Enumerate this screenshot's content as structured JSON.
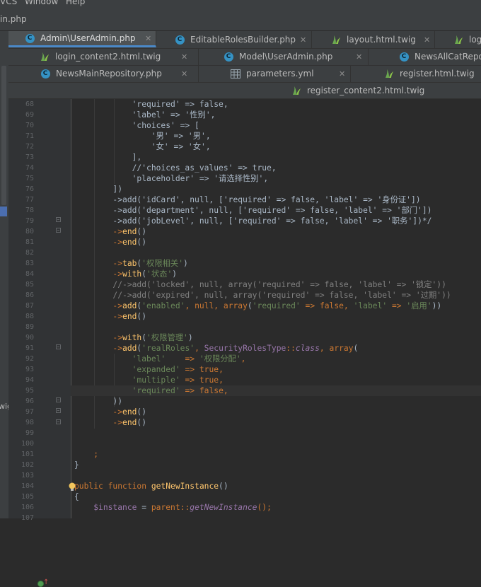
{
  "menu": [
    "VCS",
    "Window",
    "Help"
  ],
  "navbar": {
    "path": "in.php"
  },
  "sidebar": {
    "cut_text": "wig"
  },
  "tabs": [
    {
      "label": "Admin\\UserAdmin.php",
      "icon": "php-class-icon",
      "active": true
    },
    {
      "label": "EditableRolesBuilder.php",
      "icon": "php-class-icon",
      "active": false
    },
    {
      "label": "layout.html.twig",
      "icon": "twig-icon",
      "active": false
    },
    {
      "label": "log",
      "icon": "twig-icon",
      "active": false
    },
    {
      "label": "login_content2.html.twig",
      "icon": "twig-icon",
      "active": false
    },
    {
      "label": "Model\\UserAdmin.php",
      "icon": "php-class-icon",
      "active": false
    },
    {
      "label": "NewsAllCatRepo",
      "icon": "php-class-icon",
      "active": false
    },
    {
      "label": "NewsMainRepository.php",
      "icon": "php-class-icon",
      "active": false
    },
    {
      "label": "parameters.yml",
      "icon": "yml-icon",
      "active": false
    },
    {
      "label": "register.html.twig",
      "icon": "twig-icon",
      "active": false
    },
    {
      "label": "register_content2.html.twig",
      "icon": "twig-icon",
      "active": false
    }
  ],
  "editor": {
    "current_line": 95,
    "lines": [
      {
        "n": "68",
        "code": [
          [
            "            'required' => false,",
            ""
          ]
        ]
      },
      {
        "n": "69",
        "code": [
          [
            "            'label' => '性别',",
            ""
          ]
        ]
      },
      {
        "n": "70",
        "code": [
          [
            "            'choices' => [",
            ""
          ]
        ]
      },
      {
        "n": "71",
        "code": [
          [
            "                '男' => '男',",
            ""
          ]
        ]
      },
      {
        "n": "72",
        "code": [
          [
            "                '女' => '女',",
            ""
          ]
        ]
      },
      {
        "n": "73",
        "code": [
          [
            "            ],",
            ""
          ]
        ]
      },
      {
        "n": "74",
        "code": [
          [
            "            //'choices_as_values' => true,",
            ""
          ]
        ]
      },
      {
        "n": "75",
        "code": [
          [
            "            'placeholder' => '请选择性别',",
            ""
          ]
        ]
      },
      {
        "n": "76",
        "code": [
          [
            "        ])",
            ""
          ]
        ]
      },
      {
        "n": "77",
        "code": [
          [
            "        ->add('idCard', null, ['required' => false, 'label' => '身份证'])",
            ""
          ]
        ]
      },
      {
        "n": "78",
        "code": [
          [
            "        ->add('department', null, ['required' => false, 'label' => '部门'])",
            ""
          ]
        ]
      },
      {
        "n": "79",
        "code": [
          [
            "        ->add('jobLevel', null, ['required' => false, 'label' => '职务'])*/",
            ""
          ]
        ]
      },
      {
        "n": "80",
        "code": [
          [
            "        ->",
            "kw"
          ],
          [
            "end",
            "fn"
          ],
          [
            "()",
            ""
          ]
        ]
      },
      {
        "n": "81",
        "code": [
          [
            "        ->",
            "kw"
          ],
          [
            "end",
            "fn"
          ],
          [
            "()",
            ""
          ]
        ]
      },
      {
        "n": "82",
        "code": []
      },
      {
        "n": "83",
        "code": [
          [
            "        ->",
            "kw"
          ],
          [
            "tab",
            "fn"
          ],
          [
            "(",
            ""
          ],
          [
            "'权限相关'",
            "str"
          ],
          [
            ")",
            ""
          ]
        ]
      },
      {
        "n": "84",
        "code": [
          [
            "        ->",
            "kw"
          ],
          [
            "with",
            "fn"
          ],
          [
            "(",
            ""
          ],
          [
            "'状态'",
            "str"
          ],
          [
            ")",
            ""
          ]
        ]
      },
      {
        "n": "85",
        "code": [
          [
            "        //->add('locked', null, array('required' => false, 'label' => '锁定'))",
            "cmt"
          ]
        ]
      },
      {
        "n": "86",
        "code": [
          [
            "        //->add('expired', null, array('required' => false, 'label' => '过期'))",
            "cmt"
          ]
        ]
      },
      {
        "n": "87",
        "code": [
          [
            "        ->",
            "kw"
          ],
          [
            "add",
            "fn"
          ],
          [
            "(",
            ""
          ],
          [
            "'enabled'",
            "str"
          ],
          [
            ", ",
            "kw"
          ],
          [
            "null",
            "kw"
          ],
          [
            ", ",
            "kw"
          ],
          [
            "array",
            "kw"
          ],
          [
            "(",
            ""
          ],
          [
            "'required'",
            "str"
          ],
          [
            " => ",
            "kw"
          ],
          [
            "false",
            "kw"
          ],
          [
            ", ",
            "kw"
          ],
          [
            "'label'",
            "str"
          ],
          [
            " => ",
            "kw"
          ],
          [
            "'启用'",
            "str"
          ],
          [
            "))",
            ""
          ]
        ]
      },
      {
        "n": "88",
        "code": [
          [
            "        ->",
            "kw"
          ],
          [
            "end",
            "fn"
          ],
          [
            "()",
            ""
          ]
        ]
      },
      {
        "n": "89",
        "code": []
      },
      {
        "n": "90",
        "code": [
          [
            "        ->",
            "kw"
          ],
          [
            "with",
            "fn"
          ],
          [
            "(",
            ""
          ],
          [
            "'权限管理'",
            "str"
          ],
          [
            ")",
            ""
          ]
        ]
      },
      {
        "n": "91",
        "code": [
          [
            "        ->",
            "kw"
          ],
          [
            "add",
            "fn"
          ],
          [
            "(",
            ""
          ],
          [
            "'realRoles'",
            "str"
          ],
          [
            ", ",
            "kw"
          ],
          [
            "SecurityRolesType",
            "var"
          ],
          [
            "::",
            "kw"
          ],
          [
            "class",
            "it"
          ],
          [
            ", ",
            "kw"
          ],
          [
            "array",
            "kw"
          ],
          [
            "(",
            ""
          ]
        ]
      },
      {
        "n": "92",
        "code": [
          [
            "            ",
            ""
          ],
          [
            "'label'",
            "str"
          ],
          [
            "    => ",
            "kw"
          ],
          [
            "'权限分配'",
            "str"
          ],
          [
            ",",
            "kw"
          ]
        ]
      },
      {
        "n": "93",
        "code": [
          [
            "            ",
            ""
          ],
          [
            "'expanded'",
            "str"
          ],
          [
            " => ",
            "kw"
          ],
          [
            "true",
            "kw"
          ],
          [
            ",",
            "kw"
          ]
        ]
      },
      {
        "n": "94",
        "code": [
          [
            "            ",
            ""
          ],
          [
            "'multiple'",
            "str"
          ],
          [
            " => ",
            "kw"
          ],
          [
            "true",
            "kw"
          ],
          [
            ",",
            "kw"
          ]
        ]
      },
      {
        "n": "95",
        "code": [
          [
            "            ",
            ""
          ],
          [
            "'required'",
            "str"
          ],
          [
            " => ",
            "kw"
          ],
          [
            "false",
            "kw"
          ],
          [
            ",",
            "kw"
          ]
        ]
      },
      {
        "n": "96",
        "code": [
          [
            "        ))",
            ""
          ]
        ]
      },
      {
        "n": "97",
        "code": [
          [
            "        ->",
            "kw"
          ],
          [
            "end",
            "fn"
          ],
          [
            "()",
            ""
          ]
        ]
      },
      {
        "n": "98",
        "code": [
          [
            "        ->",
            "kw"
          ],
          [
            "end",
            "fn"
          ],
          [
            "()",
            ""
          ]
        ]
      },
      {
        "n": "99",
        "code": []
      },
      {
        "n": "100",
        "code": []
      },
      {
        "n": "101",
        "code": [
          [
            "    ;",
            "kw"
          ]
        ]
      },
      {
        "n": "102",
        "code": [
          [
            "}",
            ""
          ]
        ]
      },
      {
        "n": "103",
        "code": []
      },
      {
        "n": "104",
        "code": [
          [
            "public function ",
            "kw"
          ],
          [
            "getNewInstance",
            "fn"
          ],
          [
            "()",
            ""
          ]
        ]
      },
      {
        "n": "105",
        "code": [
          [
            "{",
            ""
          ]
        ]
      },
      {
        "n": "106",
        "code": [
          [
            "    ",
            ""
          ],
          [
            "$instance",
            "var"
          ],
          [
            " = ",
            ""
          ],
          [
            "parent",
            "kw"
          ],
          [
            "::",
            "kw"
          ],
          [
            "getNewInstance",
            "it"
          ],
          [
            "();",
            "kw"
          ]
        ]
      },
      {
        "n": "107",
        "code": []
      }
    ]
  }
}
